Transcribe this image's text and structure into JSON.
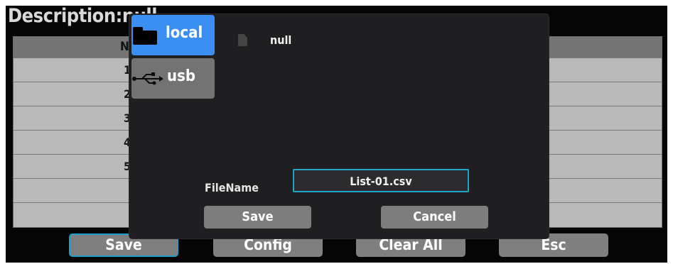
{
  "description": {
    "title": "Description:null"
  },
  "table": {
    "header": "N",
    "row_numbers": [
      "1",
      "2",
      "3",
      "4",
      "5",
      "",
      ""
    ]
  },
  "softkeys": [
    {
      "label": "Save",
      "active": true
    },
    {
      "label": "Config",
      "active": false
    },
    {
      "label": "Clear All",
      "active": false
    },
    {
      "label": "Esc",
      "active": false
    }
  ],
  "dialog": {
    "sidebar": [
      {
        "label": "local",
        "icon": "folder-icon",
        "selected": true
      },
      {
        "label": "usb",
        "icon": "usb-icon",
        "selected": false
      }
    ],
    "file_list": [
      {
        "name": "null",
        "icon": "file-icon"
      }
    ],
    "filename_label": "FileName",
    "filename_value": "List-01.csv",
    "save_label": "Save",
    "cancel_label": "Cancel"
  },
  "colors": {
    "accent": "#3c8ff2",
    "focus_border": "#1da6c8",
    "button_gray": "#7d7d7d",
    "dialog_bg": "#1f1f22"
  }
}
